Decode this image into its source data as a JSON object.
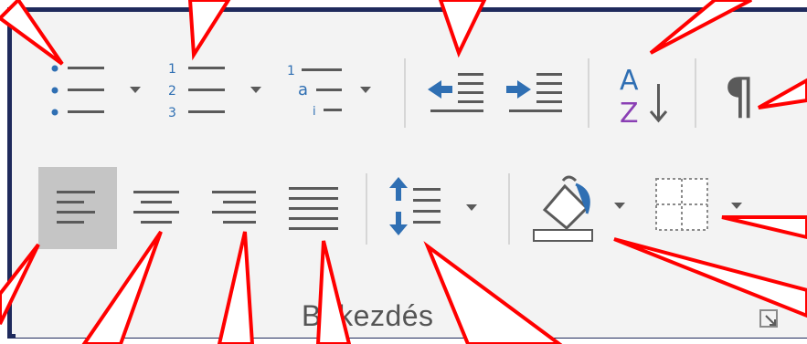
{
  "ribbon": {
    "group_label": "Bekezdés",
    "colors": {
      "icon_blue": "#2f6fb3",
      "icon_purple": "#8a3fb4",
      "icon_gray": "#5a5a5a",
      "selected_bg": "#c5c5c5",
      "frame_border": "#1f2a5c",
      "callout_red": "#ff0000"
    },
    "buttons": [
      {
        "name": "bullets-button",
        "icon": "bullets-icon",
        "dropdown": true
      },
      {
        "name": "numbering-button",
        "icon": "numbering-icon",
        "dropdown": true,
        "digits": [
          "1",
          "2",
          "3"
        ]
      },
      {
        "name": "multilevel-list-button",
        "icon": "multilevel-list-icon",
        "dropdown": true,
        "glyphs": [
          "1",
          "a",
          "i"
        ]
      },
      {
        "name": "decrease-indent-button",
        "icon": "decrease-indent-icon"
      },
      {
        "name": "increase-indent-button",
        "icon": "increase-indent-icon"
      },
      {
        "name": "sort-button",
        "icon": "sort-az-icon",
        "letters": [
          "A",
          "Z"
        ]
      },
      {
        "name": "show-formatting-marks-button",
        "icon": "pilcrow-icon",
        "glyph": "¶"
      },
      {
        "name": "align-left-button",
        "icon": "align-left-icon",
        "selected": true
      },
      {
        "name": "align-center-button",
        "icon": "align-center-icon"
      },
      {
        "name": "align-right-button",
        "icon": "align-right-icon"
      },
      {
        "name": "justify-button",
        "icon": "justify-icon"
      },
      {
        "name": "line-spacing-button",
        "icon": "line-spacing-icon",
        "dropdown": true
      },
      {
        "name": "shading-button",
        "icon": "paint-bucket-icon",
        "dropdown": true
      },
      {
        "name": "borders-button",
        "icon": "borders-icon",
        "dropdown": true
      }
    ],
    "dialog_launcher": {
      "icon": "dialog-launcher-icon"
    }
  }
}
